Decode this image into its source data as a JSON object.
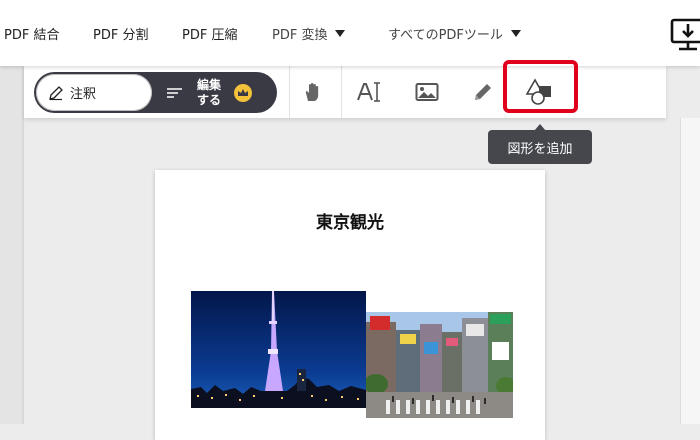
{
  "nav": {
    "items": [
      "PDF 結合",
      "PDF 分割",
      "PDF 圧縮",
      "PDF 変換",
      "すべてのPDFツール"
    ],
    "download_icon": "download-monitor-icon"
  },
  "toolbar": {
    "annotate_label": "注釈",
    "edit_label_line1": "編集",
    "edit_label_line2": "する",
    "tools": [
      "hand-icon",
      "add-text-icon",
      "image-icon",
      "pencil-icon",
      "shapes-icon"
    ]
  },
  "tooltip": {
    "text": "図形を追加"
  },
  "document": {
    "title": "東京観光",
    "images": [
      "tokyo-skytree-night-photo",
      "shibuya-crossing-photo"
    ]
  },
  "colors": {
    "highlight": "#e0001b",
    "toggle_dark": "#3a3a44",
    "tooltip_bg": "#45474d",
    "crown": "#f3c23a"
  }
}
